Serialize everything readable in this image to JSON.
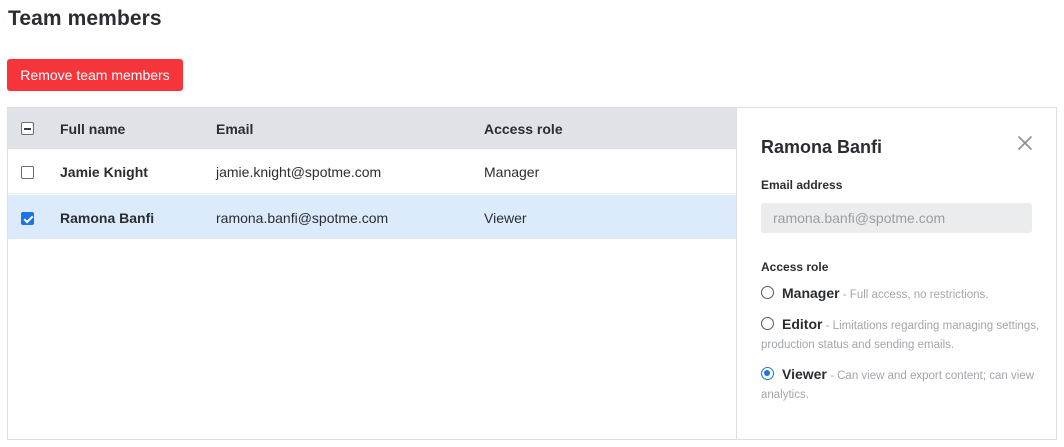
{
  "page": {
    "title": "Team members"
  },
  "toolbar": {
    "remove_label": "Remove team members"
  },
  "table": {
    "columns": {
      "name": "Full name",
      "email": "Email",
      "role": "Access role"
    },
    "rows": [
      {
        "name": "Jamie Knight",
        "email": "jamie.knight@spotme.com",
        "role": "Manager",
        "checked": false
      },
      {
        "name": "Ramona Banfi",
        "email": "ramona.banfi@spotme.com",
        "role": "Viewer",
        "checked": true
      }
    ]
  },
  "detail": {
    "title": "Ramona Banfi",
    "email_label": "Email address",
    "email_placeholder": "ramona.banfi@spotme.com",
    "role_label": "Access role",
    "options": [
      {
        "name": "Manager",
        "desc": "- Full access, no restrictions.",
        "selected": false
      },
      {
        "name": "Editor",
        "desc": "- Limitations regarding managing settings, production status and sending emails.",
        "selected": false
      },
      {
        "name": "Viewer",
        "desc": "- Can view and export content; can view analytics.",
        "selected": true
      }
    ]
  },
  "colors": {
    "danger": "#f5353a",
    "accent": "#1a73e8",
    "selected_row": "#dcebfb",
    "header_bg": "#dfe2e6"
  },
  "icons": {
    "close": "close-icon",
    "header_checkbox": "indeterminate-checkbox"
  }
}
